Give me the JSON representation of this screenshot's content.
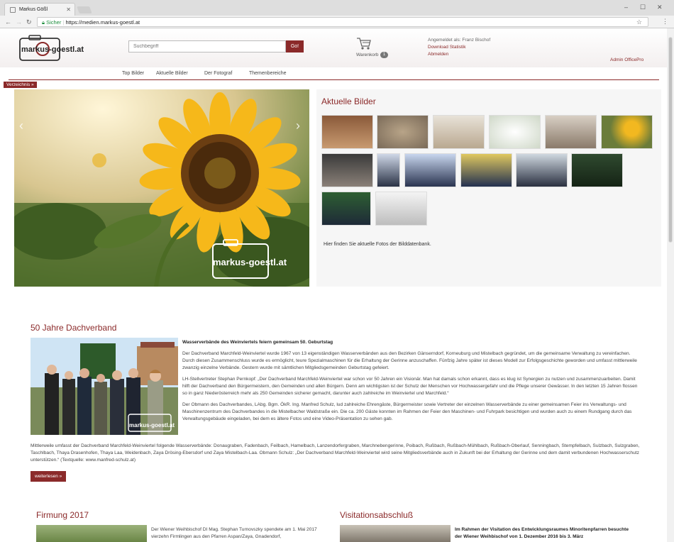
{
  "browser": {
    "tab_title": "Markus Gößl",
    "secure_label": "Sicher",
    "url": "https://medien.markus-goestl.at"
  },
  "header": {
    "logo_text": "markus-goestl.at",
    "search_placeholder": "Suchbegriff",
    "search_button": "Go!",
    "cart_label": "Warenkorb",
    "cart_count": "1",
    "user_greeting": "Angemeldet als: Franz Bischof",
    "user_links": [
      "Download Statistik",
      "Abmelden"
    ],
    "admin_link": "Admin OfficePro"
  },
  "nav": {
    "items": [
      "Top Bilder",
      "Aktuelle Bilder",
      "Der Fotograf",
      "Themenbereiche"
    ],
    "verzeichnis": "Verzeichnis »"
  },
  "hero": {
    "watermark": "markus-goestl.at"
  },
  "gallery": {
    "title": "Aktuelle Bilder",
    "description": "Hier finden Sie aktuelle Fotos der Bilddatenbank.",
    "thumb_count": 16
  },
  "article": {
    "title": "50 Jahre Dachverband",
    "headline": "Wasserverbände des Weinviertels feiern gemeinsam 50. Geburtstag",
    "p1": "Der Dachverband Marchfeld-Weinviertel wurde 1967 von 13 eigenständigen Wasserverbänden aus den Bezirken Gänserndorf, Korneuburg und Mistelbach gegründet, um die gemeinsame Verwaltung zu vereinfachen. Durch diesen Zusammenschluss wurde es ermöglicht, teure Spezialmaschinen für die Erhaltung der Gerinne anzuschaffen. Fünfzig Jahre später ist dieses Modell zur Erfolgsgeschichte geworden und umfasst mittlerweile zwanzig einzelne Verbände. Gestern wurde mit sämtlichen Mitgliedsgemeinden Geburtstag gefeiert.",
    "p2": "LH-Stellvertreter Stephan Pernkopf: „Der Dachverband Marchfeld-Weinviertel war schon vor 50 Jahren ein Visionär. Man hat damals schon erkannt, dass es klug ist Synergien zu nutzen und zusammenzuarbeiten. Damit hilft der Dachverband den Bürgermeistern, den Gemeinden und allen Bürgern. Denn am wichtigsten ist der Schutz der Menschen vor Hochwassergefahr und die Pflege unserer Gewässer. In den letzten 15 Jahren flossen so in ganz Niederösterreich mehr als 250 Gemeinden sicherer gemacht, darunter auch zahlreiche im Weinviertel und Marchfeld.“",
    "p3": "Der Obmann des Dachverbandes, LAbg. Bgm. ÖkR. Ing. Manfred Schulz, lud zahlreiche Ehrengäste, Bürgermeister sowie Vertreter der einzelnen Wasserverbände zu einer gemeinsamen Feier ins Verwaltungs- und Maschinenzentrum des Dachverbandes in die Mistelbacher Waldstraße ein. Die ca. 200 Gäste konnten im Rahmen der Feier den Maschinen- und Fuhrpark besichtigen und wurden auch zu einem Rundgang durch das Verwaltungsgebäude eingeladen, bei dem es ältere Fotos und eine Video-Präsentation zu sehen gab.",
    "p4": "Mittlerweile umfasst der Dachverband Marchfeld-Weinviertel folgende Wasserverbände: Donaugraben, Fadenbach, Feilbach, Hamelbach, Lanzendorfergraben, Marchnebengerinne, Poibach, Rußbach, Rußbach-Mühlbach, Rußbach-Oberlauf, Senningbach, Stempfelbach, Sulzbach, Sulzgraben, Taschlbach, Thaya Drasenhofen, Thaya Laa, Weidenbach, Zaya Drösing-Ebersdorf und Zaya Mistelbach-Laa. Obmann Schulz: „Der Dachverband Marchfeld-Weinviertel wird seine Mitgliedsverbände auch in Zukunft bei der Erhaltung der Gerinne und dem damit verbundenen Hochwasserschutz unterstützen.“ (Textquelle: www.manfred-schulz.at)",
    "more": "weiterlesen »",
    "watermark": "markus-goestl.at"
  },
  "bottom": {
    "left_title": "Firmung 2017",
    "left_text": "Der Wiener Weihbischof DI Mag. Stephan Turnovszky spendete am 1. Mai 2017 vierzehn Firmlingen aus den Pfarren Aspan/Zaya, Gnadendorf,",
    "right_title": "Visitationsabschluß",
    "right_text": "Im Rahmen der Visitation des Entwicklungsraumes Minoritenpfarren besuchte der Wiener Weihbischof von 1. Dezember 2016 bis 3. März"
  },
  "colors": {
    "accent": "#8b2a2a"
  }
}
